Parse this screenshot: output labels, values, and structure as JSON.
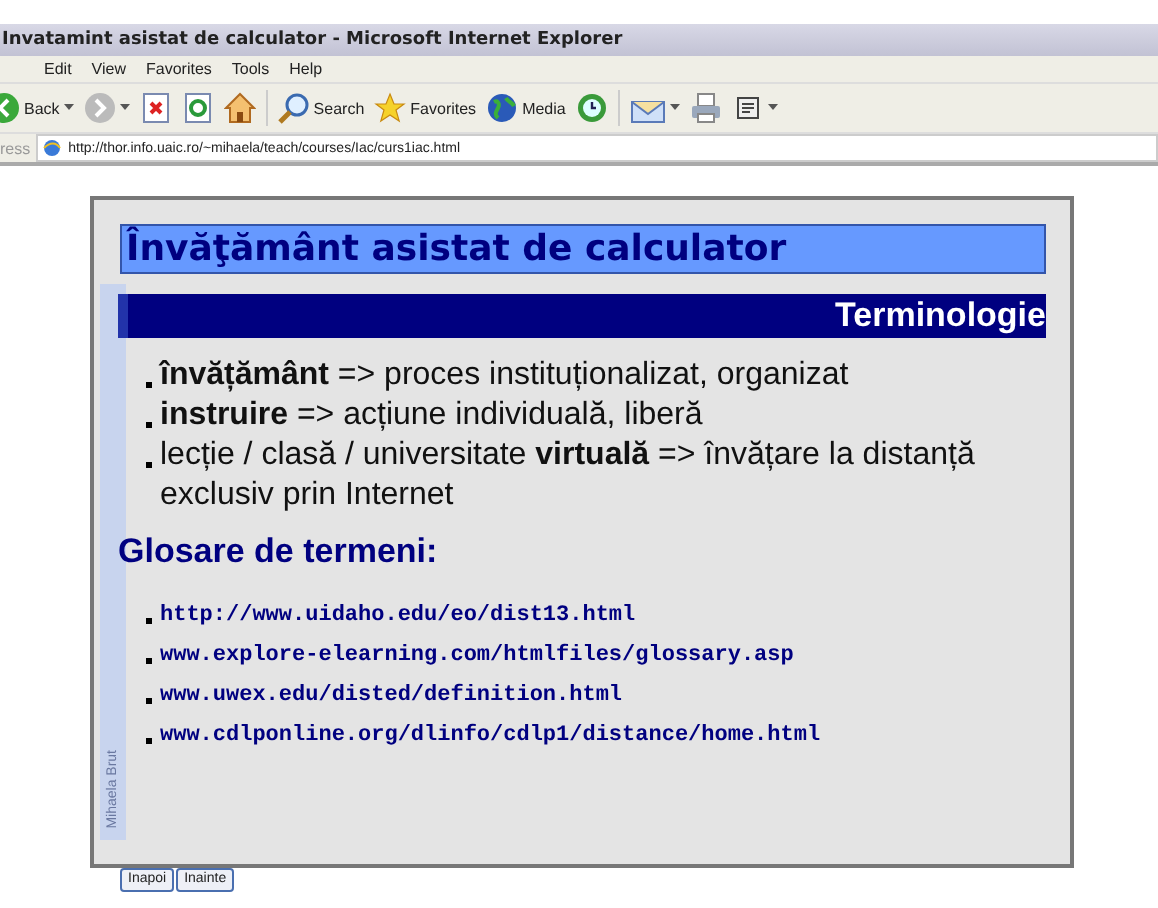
{
  "window": {
    "title": "Invatamint asistat de calculator - Microsoft Internet Explorer"
  },
  "menu": [
    "Edit",
    "View",
    "Favorites",
    "Tools",
    "Help"
  ],
  "toolbar": [
    {
      "kind": "back",
      "label": "Back"
    },
    {
      "kind": "forward"
    },
    {
      "kind": "stop"
    },
    {
      "kind": "refresh"
    },
    {
      "kind": "home"
    },
    {
      "kind": "search",
      "label": "Search"
    },
    {
      "kind": "favorites",
      "label": "Favorites"
    },
    {
      "kind": "media",
      "label": "Media"
    },
    {
      "kind": "history"
    },
    {
      "kind": "mail"
    },
    {
      "kind": "print"
    },
    {
      "kind": "edit"
    }
  ],
  "address": {
    "label": "ress",
    "value": "http://thor.info.uaic.ro/~mihaela/teach/courses/Iac/curs1iac.html"
  },
  "slide": {
    "title": "Învăţământ asistat de calculator",
    "section": "Terminologie",
    "author": "Mihaela Brut",
    "bullets": [
      "**învățământ** => proces instituționalizat, organizat",
      "**instruire** => acțiune individuală, liberă",
      "lecție / clasă / universitate **virtuală** => învățare la distanță exclusiv prin Internet"
    ],
    "glossary_heading": "Glosare de termeni:",
    "links": [
      "http://www.uidaho.edu/eo/dist13.html",
      "www.explore-elearning.com/htmlfiles/glossary.asp",
      "www.uwex.edu/disted/definition.html",
      "www.cdlponline.org/dlinfo/cdlp1/distance/home.html"
    ]
  },
  "nav_buttons": [
    "Inapoi",
    "Inainte"
  ]
}
